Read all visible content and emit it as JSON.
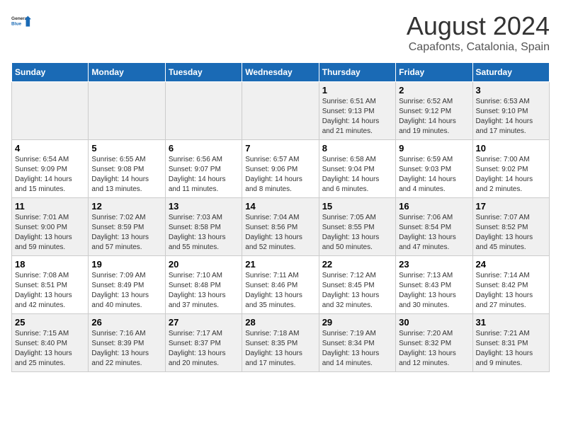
{
  "logo": {
    "line1": "General",
    "line2": "Blue"
  },
  "title": "August 2024",
  "subtitle": "Capafonts, Catalonia, Spain",
  "days_of_week": [
    "Sunday",
    "Monday",
    "Tuesday",
    "Wednesday",
    "Thursday",
    "Friday",
    "Saturday"
  ],
  "weeks": [
    [
      {
        "day": "",
        "info": ""
      },
      {
        "day": "",
        "info": ""
      },
      {
        "day": "",
        "info": ""
      },
      {
        "day": "",
        "info": ""
      },
      {
        "day": "1",
        "info": "Sunrise: 6:51 AM\nSunset: 9:13 PM\nDaylight: 14 hours\nand 21 minutes."
      },
      {
        "day": "2",
        "info": "Sunrise: 6:52 AM\nSunset: 9:12 PM\nDaylight: 14 hours\nand 19 minutes."
      },
      {
        "day": "3",
        "info": "Sunrise: 6:53 AM\nSunset: 9:10 PM\nDaylight: 14 hours\nand 17 minutes."
      }
    ],
    [
      {
        "day": "4",
        "info": "Sunrise: 6:54 AM\nSunset: 9:09 PM\nDaylight: 14 hours\nand 15 minutes."
      },
      {
        "day": "5",
        "info": "Sunrise: 6:55 AM\nSunset: 9:08 PM\nDaylight: 14 hours\nand 13 minutes."
      },
      {
        "day": "6",
        "info": "Sunrise: 6:56 AM\nSunset: 9:07 PM\nDaylight: 14 hours\nand 11 minutes."
      },
      {
        "day": "7",
        "info": "Sunrise: 6:57 AM\nSunset: 9:06 PM\nDaylight: 14 hours\nand 8 minutes."
      },
      {
        "day": "8",
        "info": "Sunrise: 6:58 AM\nSunset: 9:04 PM\nDaylight: 14 hours\nand 6 minutes."
      },
      {
        "day": "9",
        "info": "Sunrise: 6:59 AM\nSunset: 9:03 PM\nDaylight: 14 hours\nand 4 minutes."
      },
      {
        "day": "10",
        "info": "Sunrise: 7:00 AM\nSunset: 9:02 PM\nDaylight: 14 hours\nand 2 minutes."
      }
    ],
    [
      {
        "day": "11",
        "info": "Sunrise: 7:01 AM\nSunset: 9:00 PM\nDaylight: 13 hours\nand 59 minutes."
      },
      {
        "day": "12",
        "info": "Sunrise: 7:02 AM\nSunset: 8:59 PM\nDaylight: 13 hours\nand 57 minutes."
      },
      {
        "day": "13",
        "info": "Sunrise: 7:03 AM\nSunset: 8:58 PM\nDaylight: 13 hours\nand 55 minutes."
      },
      {
        "day": "14",
        "info": "Sunrise: 7:04 AM\nSunset: 8:56 PM\nDaylight: 13 hours\nand 52 minutes."
      },
      {
        "day": "15",
        "info": "Sunrise: 7:05 AM\nSunset: 8:55 PM\nDaylight: 13 hours\nand 50 minutes."
      },
      {
        "day": "16",
        "info": "Sunrise: 7:06 AM\nSunset: 8:54 PM\nDaylight: 13 hours\nand 47 minutes."
      },
      {
        "day": "17",
        "info": "Sunrise: 7:07 AM\nSunset: 8:52 PM\nDaylight: 13 hours\nand 45 minutes."
      }
    ],
    [
      {
        "day": "18",
        "info": "Sunrise: 7:08 AM\nSunset: 8:51 PM\nDaylight: 13 hours\nand 42 minutes."
      },
      {
        "day": "19",
        "info": "Sunrise: 7:09 AM\nSunset: 8:49 PM\nDaylight: 13 hours\nand 40 minutes."
      },
      {
        "day": "20",
        "info": "Sunrise: 7:10 AM\nSunset: 8:48 PM\nDaylight: 13 hours\nand 37 minutes."
      },
      {
        "day": "21",
        "info": "Sunrise: 7:11 AM\nSunset: 8:46 PM\nDaylight: 13 hours\nand 35 minutes."
      },
      {
        "day": "22",
        "info": "Sunrise: 7:12 AM\nSunset: 8:45 PM\nDaylight: 13 hours\nand 32 minutes."
      },
      {
        "day": "23",
        "info": "Sunrise: 7:13 AM\nSunset: 8:43 PM\nDaylight: 13 hours\nand 30 minutes."
      },
      {
        "day": "24",
        "info": "Sunrise: 7:14 AM\nSunset: 8:42 PM\nDaylight: 13 hours\nand 27 minutes."
      }
    ],
    [
      {
        "day": "25",
        "info": "Sunrise: 7:15 AM\nSunset: 8:40 PM\nDaylight: 13 hours\nand 25 minutes."
      },
      {
        "day": "26",
        "info": "Sunrise: 7:16 AM\nSunset: 8:39 PM\nDaylight: 13 hours\nand 22 minutes."
      },
      {
        "day": "27",
        "info": "Sunrise: 7:17 AM\nSunset: 8:37 PM\nDaylight: 13 hours\nand 20 minutes."
      },
      {
        "day": "28",
        "info": "Sunrise: 7:18 AM\nSunset: 8:35 PM\nDaylight: 13 hours\nand 17 minutes."
      },
      {
        "day": "29",
        "info": "Sunrise: 7:19 AM\nSunset: 8:34 PM\nDaylight: 13 hours\nand 14 minutes."
      },
      {
        "day": "30",
        "info": "Sunrise: 7:20 AM\nSunset: 8:32 PM\nDaylight: 13 hours\nand 12 minutes."
      },
      {
        "day": "31",
        "info": "Sunrise: 7:21 AM\nSunset: 8:31 PM\nDaylight: 13 hours\nand 9 minutes."
      }
    ]
  ]
}
